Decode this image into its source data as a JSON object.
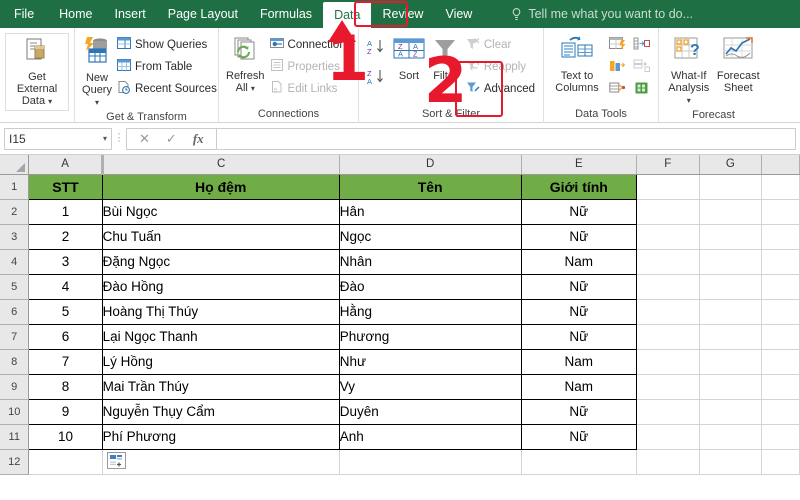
{
  "app": {
    "tellme_placeholder": "Tell me what you want to do...",
    "accent_green": "#1e6f43",
    "header_fill": "#70ad47",
    "annotation_color": "#e8192c"
  },
  "tabs": [
    {
      "label": "File",
      "active": false
    },
    {
      "label": "Home",
      "active": false
    },
    {
      "label": "Insert",
      "active": false
    },
    {
      "label": "Page Layout",
      "active": false
    },
    {
      "label": "Formulas",
      "active": false
    },
    {
      "label": "Data",
      "active": true
    },
    {
      "label": "Review",
      "active": false
    },
    {
      "label": "View",
      "active": false
    }
  ],
  "ribbon": {
    "groups": [
      {
        "title": "",
        "big": [
          {
            "label_line1": "Get External",
            "label_line2": "Data",
            "icon": "get-external-data-icon",
            "has_caret": true
          }
        ],
        "small": []
      },
      {
        "title": "Get & Transform",
        "big": [
          {
            "label_line1": "New",
            "label_line2": "Query",
            "icon": "new-query-icon",
            "has_caret": true
          }
        ],
        "small": [
          {
            "label": "Show Queries",
            "icon": "show-queries-icon",
            "disabled": false
          },
          {
            "label": "From Table",
            "icon": "from-table-icon",
            "disabled": false
          },
          {
            "label": "Recent Sources",
            "icon": "recent-sources-icon",
            "disabled": false
          }
        ]
      },
      {
        "title": "Connections",
        "big": [
          {
            "label_line1": "Refresh",
            "label_line2": "All",
            "icon": "refresh-all-icon",
            "has_caret": true
          }
        ],
        "small": [
          {
            "label": "Connections",
            "icon": "connections-icon",
            "disabled": false
          },
          {
            "label": "Properties",
            "icon": "properties-icon",
            "disabled": true
          },
          {
            "label": "Edit Links",
            "icon": "edit-links-icon",
            "disabled": true
          }
        ]
      },
      {
        "title": "Sort & Filter",
        "sort_buttons": [
          {
            "icon": "sort-az-icon",
            "name": "sort-ascending-button"
          },
          {
            "icon": "sort-za-icon",
            "name": "sort-descending-button"
          }
        ],
        "big": [
          {
            "label_line1": "Sort",
            "label_line2": "",
            "icon": "sort-icon",
            "has_caret": false
          },
          {
            "label_line1": "Filter",
            "label_line2": "",
            "icon": "filter-icon",
            "has_caret": false,
            "highlighted": true
          }
        ],
        "small": [
          {
            "label": "Clear",
            "icon": "clear-filter-icon",
            "disabled": true
          },
          {
            "label": "Reapply",
            "icon": "reapply-icon",
            "disabled": true
          },
          {
            "label": "Advanced",
            "icon": "advanced-icon",
            "disabled": false
          }
        ]
      },
      {
        "title": "Data Tools",
        "big": [
          {
            "label_line1": "Text to",
            "label_line2": "Columns",
            "icon": "text-to-columns-icon",
            "has_caret": false
          }
        ],
        "tool_icons": [
          "flash-fill-icon",
          "remove-duplicates-icon",
          "data-validation-icon",
          "consolidate-icon",
          "relationships-icon",
          "manage-data-model-icon"
        ]
      },
      {
        "title": "Forecast",
        "big": [
          {
            "label_line1": "What-If",
            "label_line2": "Analysis",
            "icon": "what-if-analysis-icon",
            "has_caret": true
          },
          {
            "label_line1": "Forecast",
            "label_line2": "Sheet",
            "icon": "forecast-sheet-icon",
            "has_caret": false
          }
        ]
      }
    ]
  },
  "formula_bar": {
    "name_box_value": "I15",
    "cancel_icon": "cancel-icon",
    "confirm_icon": "confirm-icon",
    "function_icon": "insert-function-icon",
    "formula_value": ""
  },
  "sheet": {
    "column_headers": [
      "A",
      "C",
      "D",
      "E",
      "F",
      "G"
    ],
    "row_numbers": [
      "1",
      "2",
      "3",
      "4",
      "5",
      "6",
      "7",
      "8",
      "9",
      "10",
      "11",
      "12"
    ],
    "header_row": {
      "row": "1",
      "cells": [
        "STT",
        "Họ đệm",
        "Tên",
        "Giới tính"
      ]
    },
    "rows": [
      {
        "row": "2",
        "stt": "1",
        "ho_dem": "Bùi Ngọc",
        "ten": "Hân",
        "gioi_tinh": "Nữ"
      },
      {
        "row": "3",
        "stt": "2",
        "ho_dem": "Chu Tuấn",
        "ten": "Ngọc",
        "gioi_tinh": "Nữ"
      },
      {
        "row": "4",
        "stt": "3",
        "ho_dem": "Đặng Ngọc",
        "ten": "Nhân",
        "gioi_tinh": "Nam"
      },
      {
        "row": "5",
        "stt": "4",
        "ho_dem": "Đào Hồng",
        "ten": "Đào",
        "gioi_tinh": "Nữ"
      },
      {
        "row": "6",
        "stt": "5",
        "ho_dem": "Hoàng Thị Thúy",
        "ten": "Hằng",
        "gioi_tinh": "Nữ"
      },
      {
        "row": "7",
        "stt": "6",
        "ho_dem": "Lại Ngọc Thanh",
        "ten": "Phương",
        "gioi_tinh": "Nữ"
      },
      {
        "row": "8",
        "stt": "7",
        "ho_dem": "Lý Hồng",
        "ten": "Như",
        "gioi_tinh": "Nam"
      },
      {
        "row": "9",
        "stt": "8",
        "ho_dem": "Mai Trần Thúy",
        "ten": "Vy",
        "gioi_tinh": "Nam"
      },
      {
        "row": "10",
        "stt": "9",
        "ho_dem": "Nguyễn Thụy Cẩm",
        "ten": "Duyên",
        "gioi_tinh": "Nữ"
      },
      {
        "row": "11",
        "stt": "10",
        "ho_dem": "Phí Phương",
        "ten": "Anh",
        "gioi_tinh": "Nữ"
      },
      {
        "row": "12",
        "stt": "",
        "ho_dem": "",
        "ten": "",
        "gioi_tinh": ""
      }
    ],
    "quick_analysis_icon": "quick-analysis-icon"
  },
  "annotations": [
    {
      "label": "1",
      "points_to": "Data tab"
    },
    {
      "label": "2",
      "points_to": "Filter button"
    }
  ]
}
